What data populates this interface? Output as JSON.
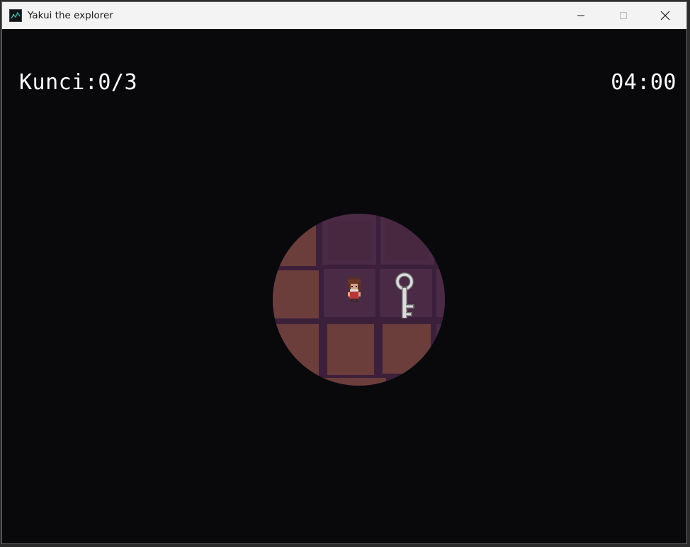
{
  "window": {
    "title": "Yakui the explorer",
    "controls": {
      "minimize": "minimize",
      "maximize": "maximize",
      "close": "close"
    }
  },
  "hud": {
    "keys_label": "Kunci:0/3",
    "timer": "04:00"
  },
  "scene": {
    "player": "player-character",
    "items": [
      "key"
    ],
    "colors": {
      "background": "#09090c",
      "floor": "#6b3e3c",
      "wall": "#4a2a44",
      "grout": "#3c1f3a",
      "key": "#d9d9d9"
    }
  }
}
